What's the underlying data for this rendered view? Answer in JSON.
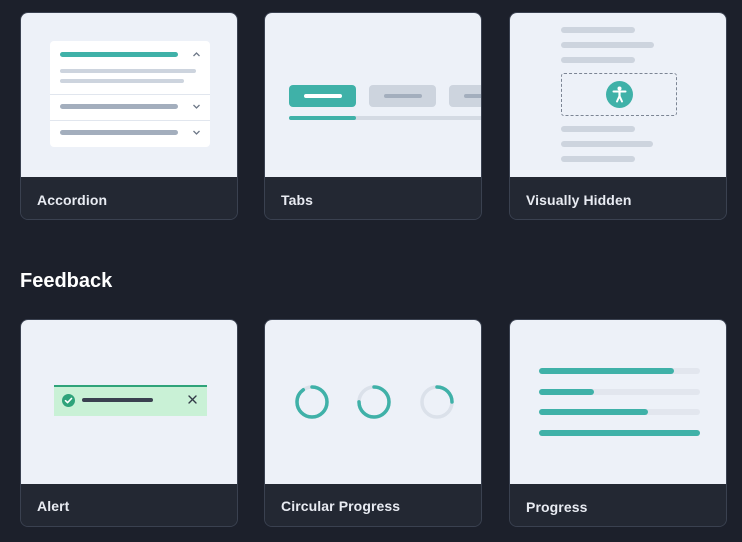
{
  "sections": {
    "feedback_title": "Feedback"
  },
  "cards": {
    "accordion": {
      "label": "Accordion"
    },
    "tabs": {
      "label": "Tabs"
    },
    "visually_hidden": {
      "label": "Visually Hidden"
    },
    "alert": {
      "label": "Alert"
    },
    "circular_progress": {
      "label": "Circular Progress"
    },
    "progress": {
      "label": "Progress"
    }
  },
  "previews": {
    "circular_progress": {
      "values": [
        0.9,
        0.75,
        0.25
      ]
    },
    "progress": {
      "values": [
        0.84,
        0.34,
        0.68,
        1.0
      ]
    }
  },
  "colors": {
    "page_bg": "#1c202b",
    "card_footer_bg": "#232833",
    "preview_bg": "#edf1f8",
    "accent": "#3fb1a8",
    "alert_bg": "#c9f1d6",
    "alert_border": "#2fa37a"
  },
  "icons": {
    "accessibility": "accessibility-icon",
    "check": "check-circle-icon",
    "close": "close-icon",
    "chevron_up": "chevron-up-icon",
    "chevron_down": "chevron-down-icon"
  }
}
